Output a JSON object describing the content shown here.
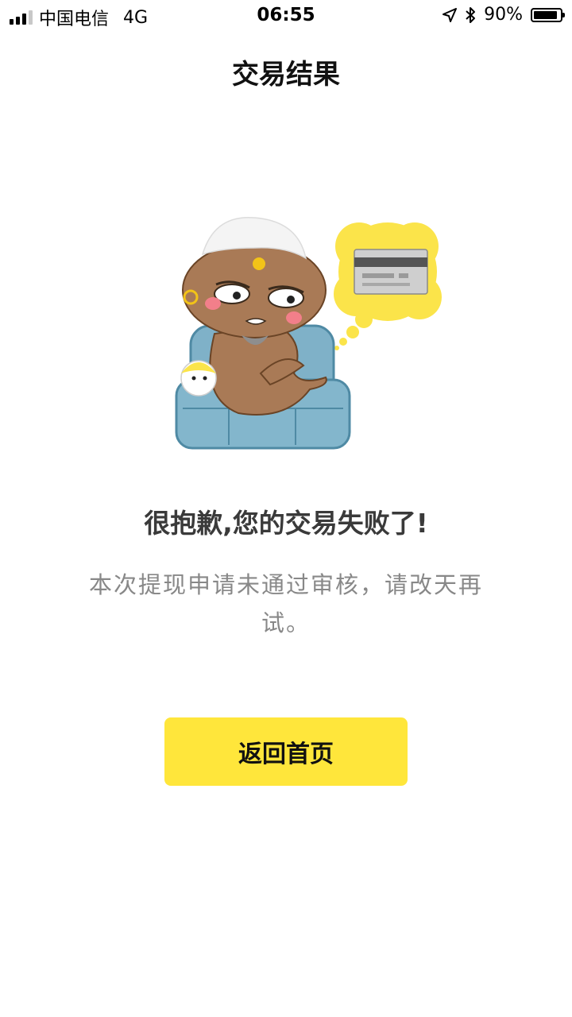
{
  "status_bar": {
    "carrier": "中国电信",
    "network": "4G",
    "time": "06:55",
    "battery_percent_text": "90%",
    "battery_level": 0.9,
    "icons": [
      "signal-icon",
      "location-arrow-icon",
      "bluetooth-icon",
      "battery-icon"
    ]
  },
  "nav": {
    "title": "交易结果"
  },
  "result": {
    "illustration": "genie-with-credit-card-illustration",
    "headline": "很抱歉,您的交易失败了!",
    "message": "本次提现申请未通过审核，请改天再试。"
  },
  "actions": {
    "home_label": "返回首页",
    "home_color": "#ffe63b"
  }
}
